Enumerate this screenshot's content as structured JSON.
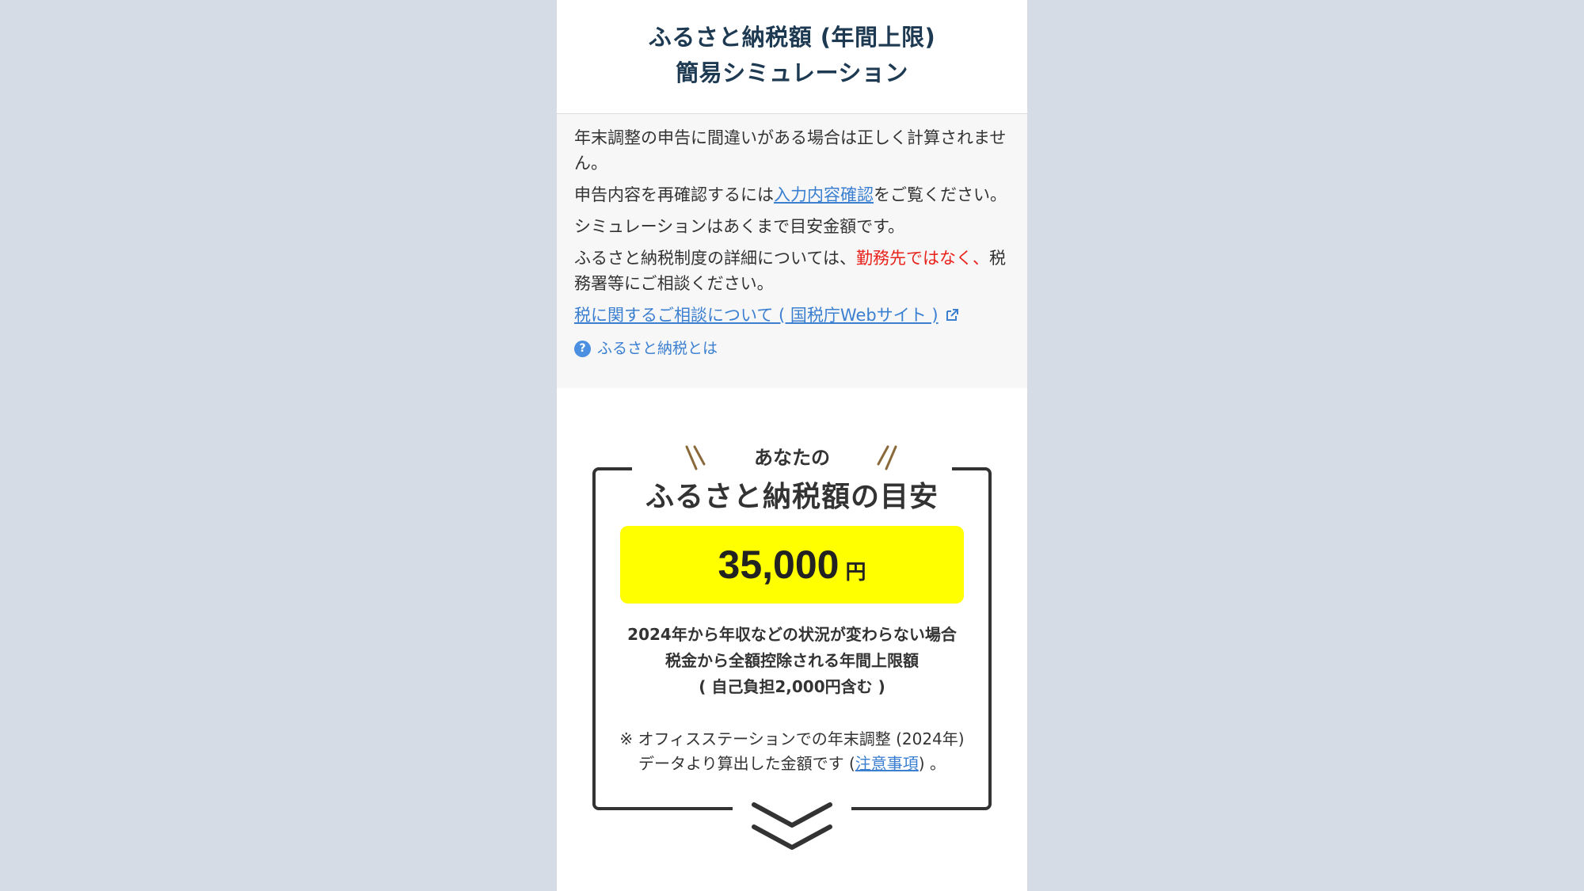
{
  "header": {
    "title_line1": "ふるさと納税額 (年間上限)",
    "title_line2": "簡易シミュレーション"
  },
  "notice": {
    "p1": "年末調整の申告に間違いがある場合は正しく計算されません。",
    "p2_prefix": "申告内容を再確認するには",
    "p2_link": "入力内容確認",
    "p2_suffix": "をご覧ください。",
    "p3": "シミュレーションはあくまで目安金額です。",
    "p4_prefix": "ふるさと納税制度の詳細については、",
    "p4_red": "勤務先ではなく、",
    "p4_suffix": "税務署等にご相談ください。",
    "ext_link": "税に関するご相談について ( 国税庁Webサイト )",
    "help_link": "ふるさと納税とは"
  },
  "result": {
    "anata": "あなたの",
    "title": "ふるさと納税額の目安",
    "amount": "35,000",
    "unit": "円",
    "desc1": "2024年から年収などの状況が変わらない場合",
    "desc2": "税金から全額控除される年間上限額",
    "desc3": "( 自己負担2,000円含む )",
    "foot_line1": "※ オフィスステーションでの年末調整 (2024年)",
    "foot_prefix": "データより算出した金額です (",
    "foot_link": "注意事項",
    "foot_suffix": ") 。"
  },
  "colors": {
    "background": "#d5dce6",
    "title": "#1d3a52",
    "link": "#3b7fd1",
    "red": "#e8231c",
    "highlight": "#ffff00"
  }
}
